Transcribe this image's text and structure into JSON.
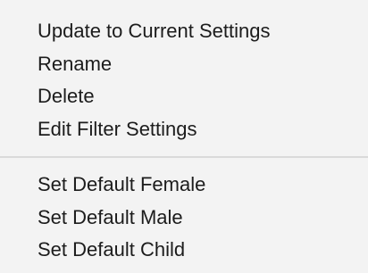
{
  "menu": {
    "group_1": [
      {
        "label": "Update to Current Settings"
      },
      {
        "label": "Rename"
      },
      {
        "label": "Delete"
      },
      {
        "label": "Edit Filter Settings"
      }
    ],
    "group_2": [
      {
        "label": "Set Default Female"
      },
      {
        "label": "Set Default Male"
      },
      {
        "label": "Set Default Child"
      }
    ]
  },
  "colors": {
    "background": "#f3f3f3",
    "text": "#1c1c1c",
    "separator": "#d9d9d9"
  }
}
